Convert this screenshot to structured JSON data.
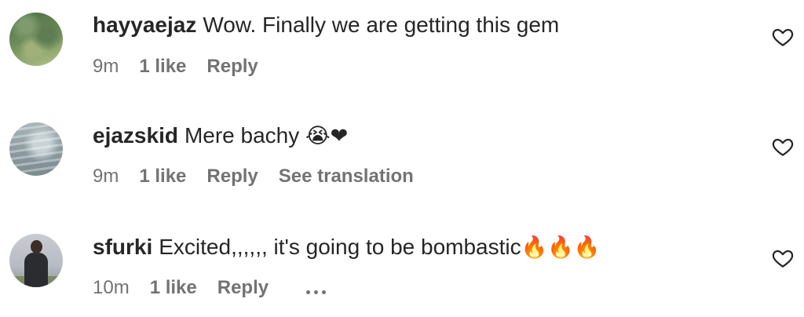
{
  "comments": [
    {
      "username": "hayyaejaz",
      "text": "Wow. Finally we are getting this gem",
      "emojis": "",
      "time": "9m",
      "likes": "1 like",
      "reply": "Reply",
      "extra_action": ""
    },
    {
      "username": "ejazskid",
      "text": "Mere bachy",
      "emojis": "😭❤",
      "time": "9m",
      "likes": "1 like",
      "reply": "Reply",
      "extra_action": "See translation"
    },
    {
      "username": "sfurki",
      "text": "Excited,,,,,, it's going to be bombastic",
      "emojis": "🔥🔥🔥",
      "time": "10m",
      "likes": "1 like",
      "reply": "Reply",
      "extra_action": "•••"
    }
  ],
  "icons": {
    "like": "heart-outline-icon",
    "more": "more-options-icon"
  },
  "colors": {
    "primary_text": "#262626",
    "secondary_text": "#737373",
    "background": "#ffffff"
  }
}
